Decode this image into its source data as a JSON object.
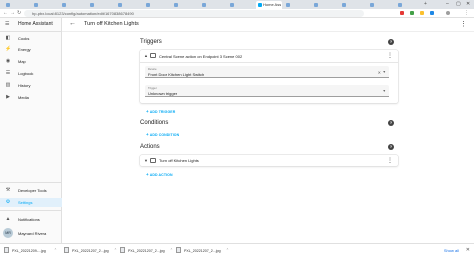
{
  "browser": {
    "address": "hp-pbx.local:8123/config/automation/edit/1670838678490",
    "active_tab_label": "Home Assistant",
    "window_controls": [
      "–",
      "▢",
      "✕"
    ]
  },
  "sidebar": {
    "app_title": "Home Assistant",
    "items": [
      {
        "label": "Cooks",
        "icon": "cook-icon",
        "glyph": "◧"
      },
      {
        "label": "Energy",
        "icon": "energy-icon",
        "glyph": "⚡"
      },
      {
        "label": "Map",
        "icon": "map-icon",
        "glyph": "◉"
      },
      {
        "label": "Logbook",
        "icon": "logbook-icon",
        "glyph": "☰"
      },
      {
        "label": "History",
        "icon": "history-icon",
        "glyph": "▥"
      },
      {
        "label": "Media",
        "icon": "media-icon",
        "glyph": "▶"
      }
    ],
    "bottom_items": [
      {
        "label": "Developer Tools",
        "icon": "developer-tools-icon",
        "glyph": "⚒"
      },
      {
        "label": "Settings",
        "icon": "settings-icon",
        "glyph": "⚙"
      },
      {
        "label": "Notifications",
        "icon": "notifications-icon",
        "glyph": "🔔"
      }
    ],
    "user": {
      "initials": "MR",
      "name": "Maynard Rivera"
    }
  },
  "header": {
    "title": "Turn off Kitchen Lights"
  },
  "triggers": {
    "section_title": "Triggers",
    "card_title": "Central Scene action on Endpoint 3 Scene 002",
    "device_label": "Device",
    "device_value": "Front Door Kitchen Light Switch",
    "trigger_label": "Trigger",
    "trigger_value": "Unknown trigger",
    "add_label": "ADD TRIGGER"
  },
  "conditions": {
    "section_title": "Conditions",
    "add_label": "ADD CONDITION"
  },
  "actions": {
    "section_title": "Actions",
    "card_title": "Turn off Kitchen Lights",
    "add_label": "ADD ACTION"
  },
  "downloads": {
    "items": [
      "PXL_20221209-...jpg",
      "PXL_20221207_2...jpg",
      "PXL_20221207_2...jpg",
      "PXL_20221207_2...jpg"
    ],
    "show_all": "Show all"
  }
}
